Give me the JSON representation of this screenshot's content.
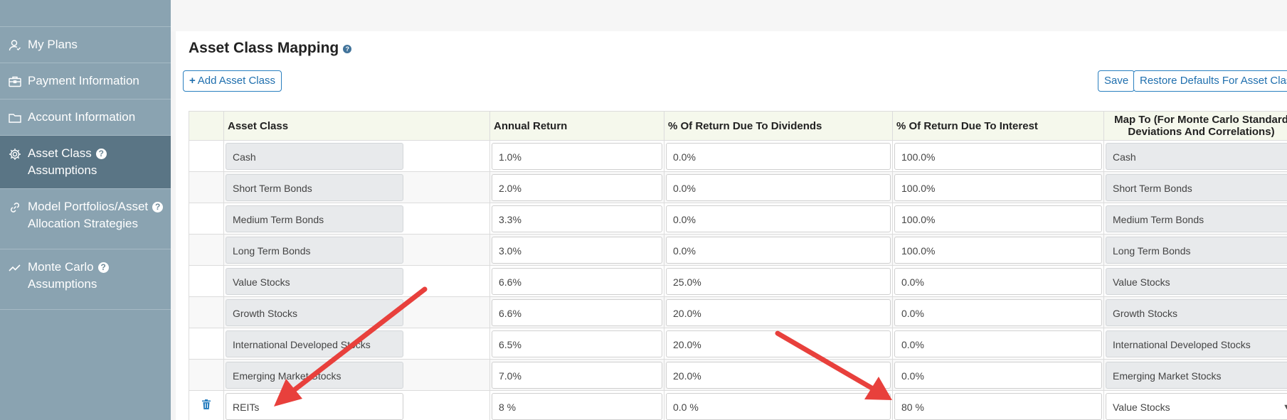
{
  "sidebar": {
    "items": [
      {
        "label": "My Plans",
        "icon": "user-icon"
      },
      {
        "label": "Payment Information",
        "icon": "briefcase-icon"
      },
      {
        "label": "Account Information",
        "icon": "folder-icon"
      },
      {
        "label_line1": "Asset Class",
        "label_line2": "Assumptions",
        "icon": "gear-icon",
        "help": "?",
        "active": true
      },
      {
        "label_line1": "Model Portfolios/Asset",
        "label_line2": "Allocation Strategies",
        "icon": "link-icon",
        "help": "?"
      },
      {
        "label_line1": "Monte Carlo",
        "label_line2": "Assumptions",
        "icon": "chart-line-icon",
        "help": "?"
      }
    ],
    "colors": {
      "background": "#8aa3b1",
      "active": "#5a7585"
    }
  },
  "page": {
    "title": "Asset Class Mapping",
    "title_help": "?"
  },
  "toolbar": {
    "add_label": "Add Asset Class",
    "save_label": "Save",
    "restore_label": "Restore Defaults For Asset Class"
  },
  "table": {
    "headers": {
      "asset_class": "Asset Class",
      "annual_return": "Annual Return",
      "dividends": "% Of Return Due To Dividends",
      "interest": "% Of Return Due To Interest",
      "map_to": "Map To (For Monte Carlo Standard Deviations And Correlations)"
    },
    "rows": [
      {
        "asset": "Cash",
        "annual": "1.0%",
        "div": "0.0%",
        "int": "100.0%",
        "map": "Cash"
      },
      {
        "asset": "Short Term Bonds",
        "annual": "2.0%",
        "div": "0.0%",
        "int": "100.0%",
        "map": "Short Term Bonds"
      },
      {
        "asset": "Medium Term Bonds",
        "annual": "3.3%",
        "div": "0.0%",
        "int": "100.0%",
        "map": "Medium Term Bonds"
      },
      {
        "asset": "Long Term Bonds",
        "annual": "3.0%",
        "div": "0.0%",
        "int": "100.0%",
        "map": "Long Term Bonds"
      },
      {
        "asset": "Value Stocks",
        "annual": "6.6%",
        "div": "25.0%",
        "int": "0.0%",
        "map": "Value Stocks"
      },
      {
        "asset": "Growth Stocks",
        "annual": "6.6%",
        "div": "20.0%",
        "int": "0.0%",
        "map": "Growth Stocks"
      },
      {
        "asset": "International Developed Stocks",
        "annual": "6.5%",
        "div": "20.0%",
        "int": "0.0%",
        "map": "International Developed Stocks"
      },
      {
        "asset": "Emerging Market Stocks",
        "annual": "7.0%",
        "div": "20.0%",
        "int": "0.0%",
        "map": "Emerging Market Stocks"
      }
    ],
    "editable_row": {
      "asset": "REITs",
      "annual": "8 %",
      "div": "0.0 %",
      "int": "80 %",
      "map": "Value Stocks",
      "delete_icon": "trash-icon"
    }
  },
  "annotations": {
    "arrow_color": "#e8403c"
  }
}
